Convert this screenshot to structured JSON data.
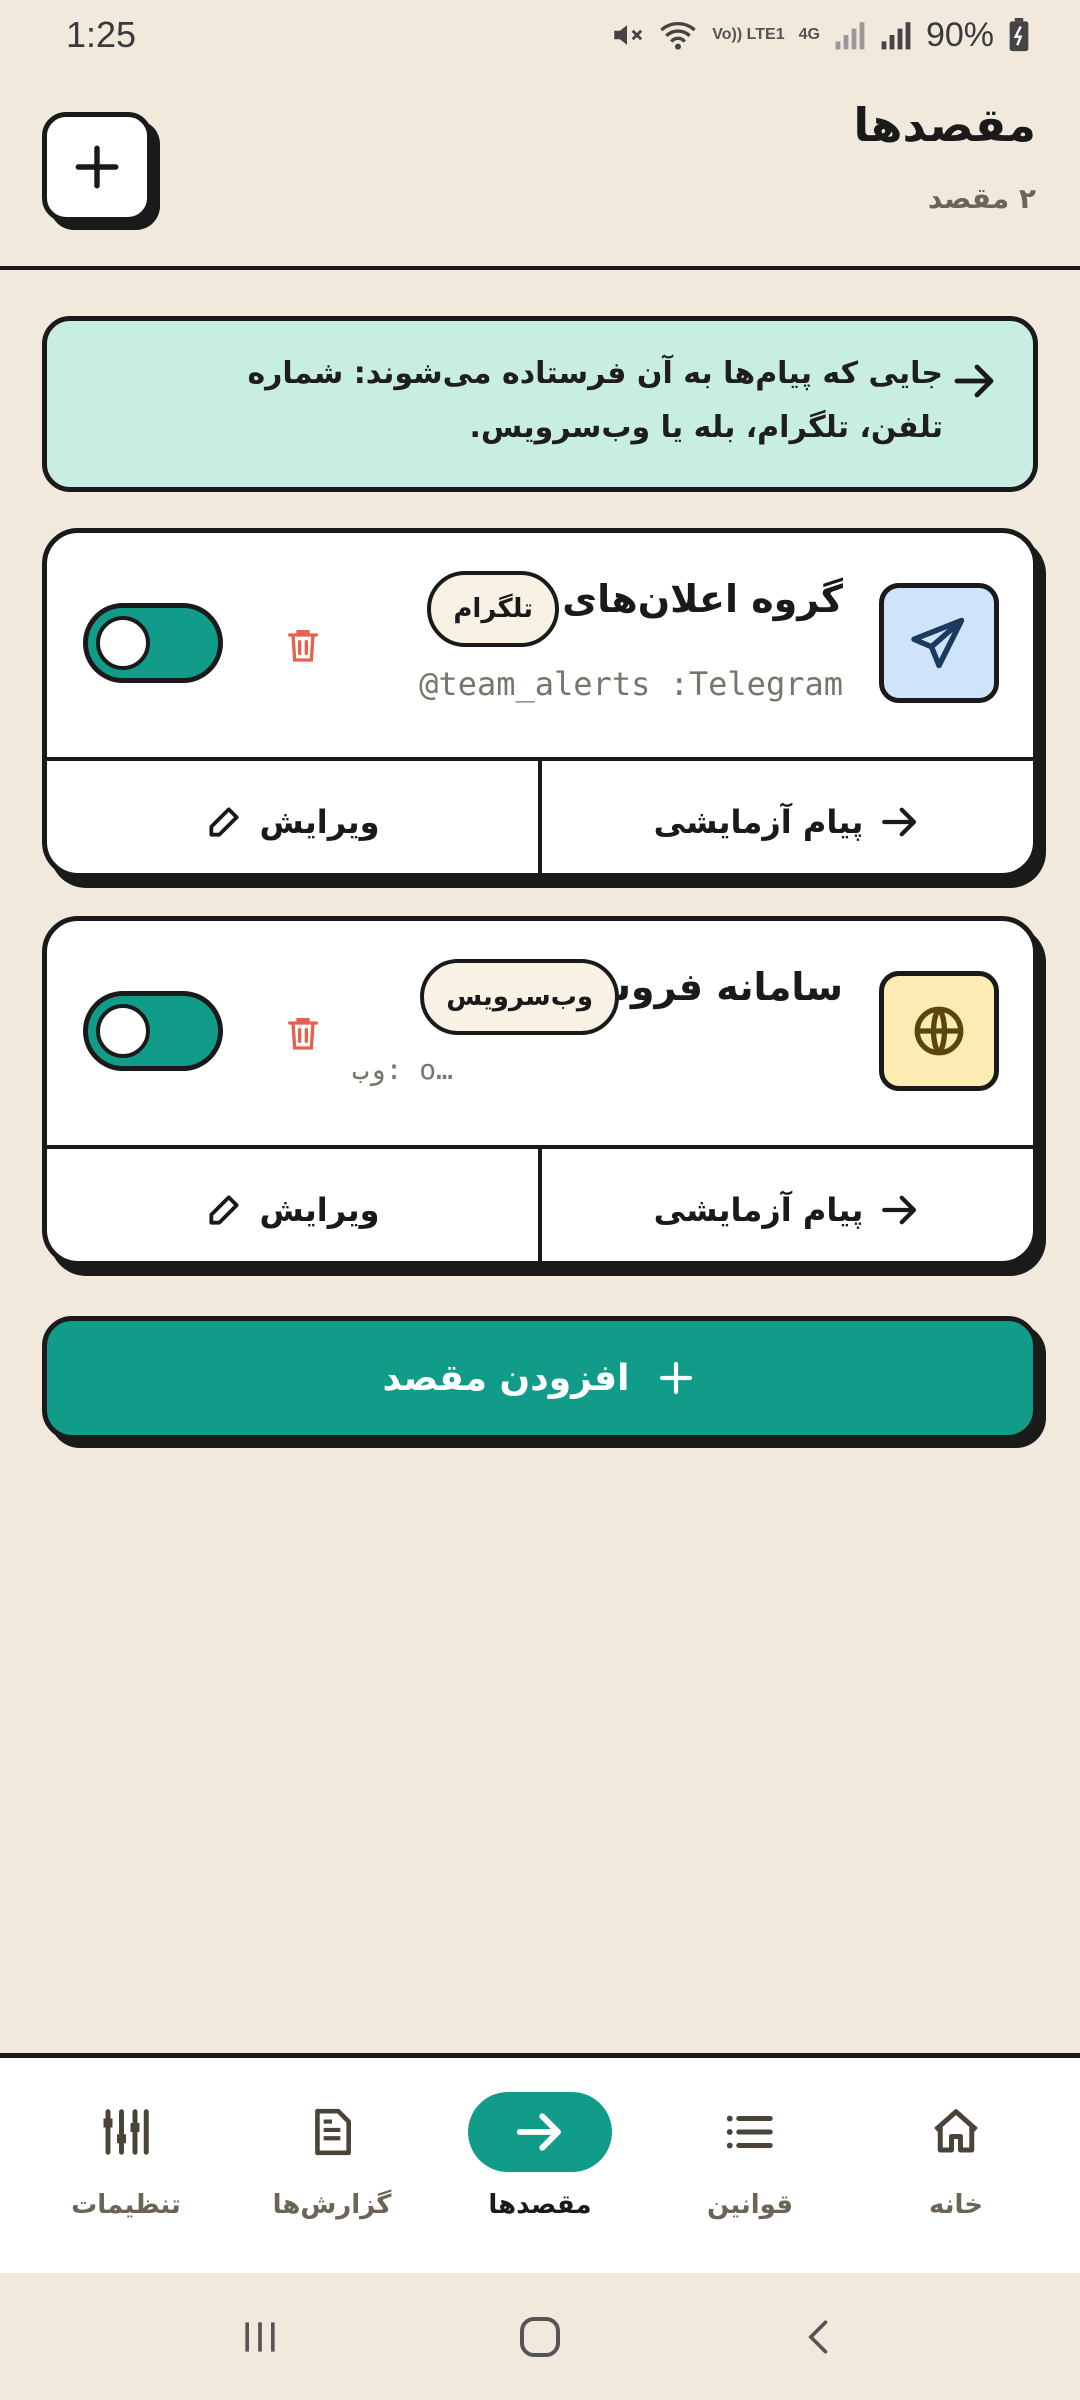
{
  "status_bar": {
    "time": "1:25",
    "volte": "Vo)) LTE1",
    "network": "4G",
    "battery": "90%"
  },
  "header": {
    "title": "مقصدها",
    "subtitle": "۲ مقصد"
  },
  "info_banner": {
    "text": "جایی که پیام‌ها به آن فرستاده می‌شوند: شماره تلفن، تلگرام، بله یا وب‌سرویس."
  },
  "destinations": [
    {
      "name": "گروه اعلان‌های تیم",
      "tag": "تلگرام",
      "detail": "@team_alerts :Telegram",
      "icon": "send-icon",
      "enabled": true,
      "test_label": "پیام آزمایشی",
      "edit_label": "ویرایش"
    },
    {
      "name": "سامانه فروش",
      "tag": "وب‌سرویس",
      "detail": "وب:  o…",
      "icon": "globe-icon",
      "enabled": true,
      "test_label": "پیام آزمایشی",
      "edit_label": "ویرایش"
    }
  ],
  "add_button": {
    "label": "افزودن مقصد"
  },
  "bottom_nav": {
    "items": [
      {
        "label": "خانه",
        "icon": "home-icon"
      },
      {
        "label": "قوانین",
        "icon": "list-icon"
      },
      {
        "label": "مقصدها",
        "icon": "arrow-right-icon",
        "active": true
      },
      {
        "label": "گزارش‌ها",
        "icon": "document-icon"
      },
      {
        "label": "تنظیمات",
        "icon": "sliders-icon"
      }
    ]
  },
  "colors": {
    "background": "#F0E9DC",
    "accent": "#109C89",
    "banner": "#C8EEE3",
    "danger": "#E8614F",
    "telegram_tile": "#CFE3FA",
    "web_tile": "#FCECB4"
  }
}
